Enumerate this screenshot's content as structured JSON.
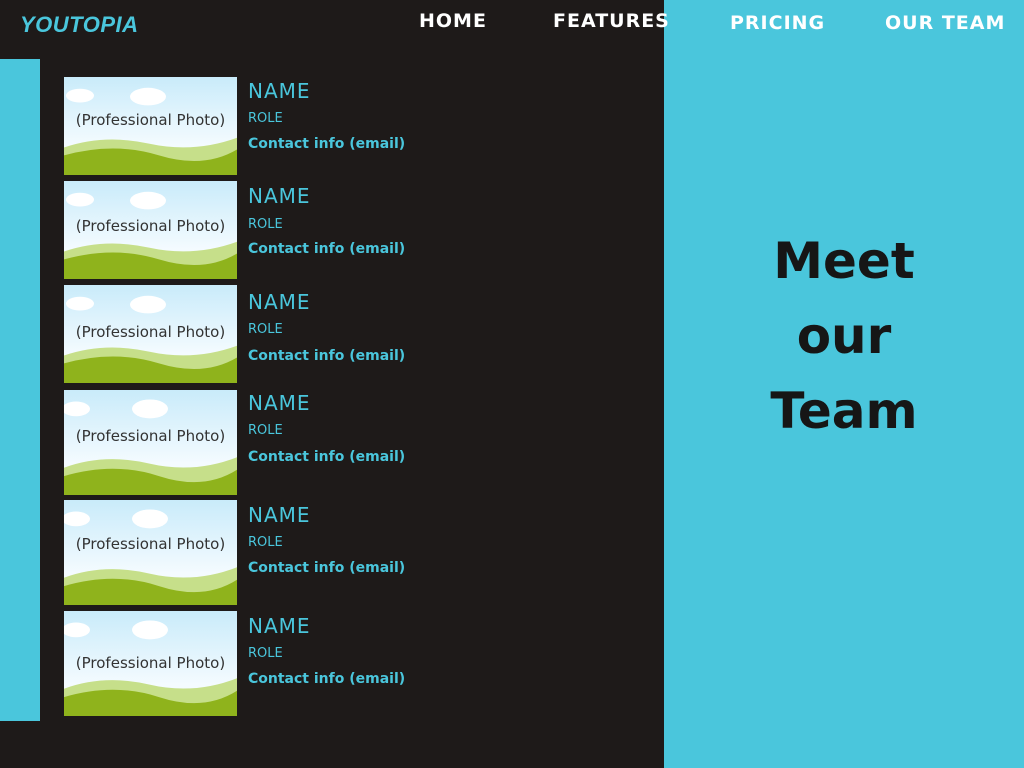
{
  "brand": {
    "logo": "YOUTOPIA"
  },
  "nav": {
    "home": "HOME",
    "features": "FEATURES",
    "pricing": "PRICING",
    "team": "OUR TEAM"
  },
  "hero": {
    "line1": "Meet",
    "line2": "our",
    "line3": "Team"
  },
  "members": [
    {
      "photo_label": "(Professional Photo)",
      "name": "NAME",
      "role": "ROLE",
      "contact": "Contact info (email)"
    },
    {
      "photo_label": "(Professional Photo)",
      "name": "NAME",
      "role": "ROLE",
      "contact": "Contact info (email)"
    },
    {
      "photo_label": "(Professional Photo)",
      "name": "NAME",
      "role": "ROLE",
      "contact": "Contact info (email)"
    },
    {
      "photo_label": "(Professional Photo)",
      "name": "NAME",
      "role": "ROLE",
      "contact": "Contact info (email)"
    },
    {
      "photo_label": "(Professional Photo)",
      "name": "NAME",
      "role": "ROLE",
      "contact": "Contact info (email)"
    },
    {
      "photo_label": "(Professional Photo)",
      "name": "NAME",
      "role": "ROLE",
      "contact": "Contact info (email)"
    }
  ],
  "colors": {
    "accent": "#4ac6dc",
    "background": "#1e1a19",
    "heading": "#161616"
  }
}
